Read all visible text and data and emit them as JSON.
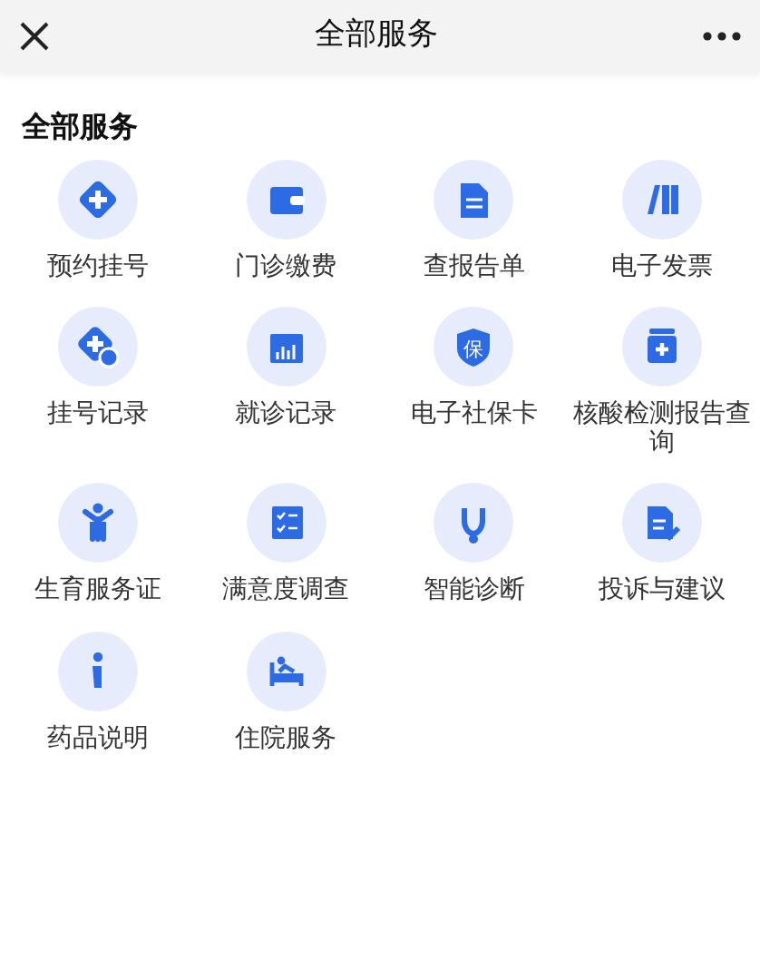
{
  "header": {
    "title": "全部服务"
  },
  "section": {
    "title": "全部服务"
  },
  "services": [
    {
      "label": "预约挂号"
    },
    {
      "label": "门诊缴费"
    },
    {
      "label": "查报告单"
    },
    {
      "label": "电子发票"
    },
    {
      "label": "挂号记录"
    },
    {
      "label": "就诊记录"
    },
    {
      "label": "电子社保卡",
      "icon_text": "保"
    },
    {
      "label": "核酸检测报告查询"
    },
    {
      "label": "生育服务证"
    },
    {
      "label": "满意度调查"
    },
    {
      "label": "智能诊断"
    },
    {
      "label": "投诉与建议"
    },
    {
      "label": "药品说明"
    },
    {
      "label": "住院服务"
    }
  ]
}
